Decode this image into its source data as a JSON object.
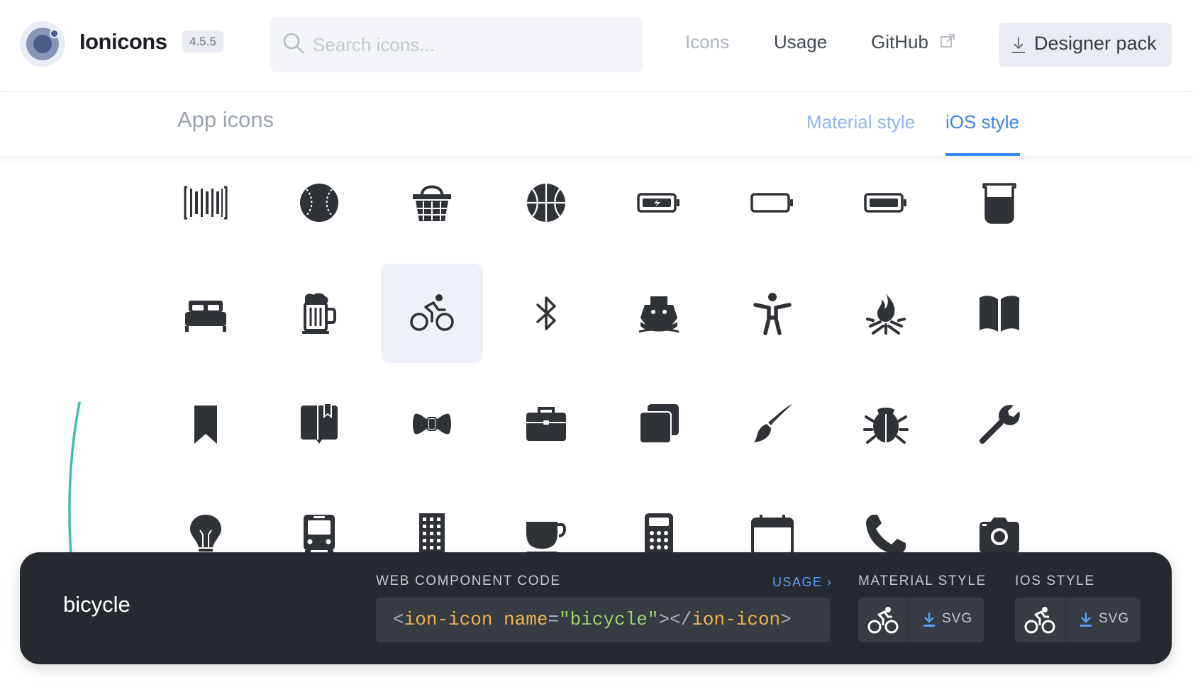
{
  "header": {
    "brand": "Ionicons",
    "version": "4.5.5",
    "search_placeholder": "Search icons...",
    "nav": {
      "icons": "Icons",
      "usage": "Usage",
      "github": "GitHub"
    },
    "designer_pack": "Designer pack"
  },
  "subheader": {
    "title": "App icons",
    "tabs": [
      {
        "label": "Material style",
        "active": false
      },
      {
        "label": "iOS style",
        "active": true
      }
    ]
  },
  "grid": {
    "rows": [
      [
        "barcode-icon",
        "baseball-icon",
        "basket-icon",
        "basketball-icon",
        "battery-charging-icon",
        "battery-dead-icon",
        "battery-full-icon",
        "beaker-icon"
      ],
      [
        "bed-icon",
        "beer-icon",
        "bicycle-icon",
        "bluetooth-icon",
        "boat-icon",
        "body-icon",
        "bonfire-icon",
        "book-icon"
      ],
      [
        "bookmark-icon",
        "bookmarks-icon",
        "bowtie-icon",
        "briefcase-icon",
        "browsers-icon",
        "brush-icon",
        "bug-icon",
        "build-icon"
      ],
      [
        "bulb-icon",
        "bus-icon",
        "business-icon",
        "cafe-icon",
        "calculator-icon",
        "calendar-icon",
        "call-icon",
        "camera-icon"
      ]
    ],
    "selected": "bicycle-icon"
  },
  "colors": {
    "accent": "#3a86f0",
    "panel": "#262a30",
    "arrow": "#3fbfa9",
    "icon": "#2f3237"
  },
  "panel": {
    "icon_name": "bicycle",
    "code_caption": "WEB COMPONENT CODE",
    "usage_link": "USAGE ›",
    "code": {
      "open": "<",
      "tag": "ion-icon",
      "attr": "name",
      "eq": "=",
      "value": "\"bicycle\"",
      "mid": "></",
      "close": ">"
    },
    "material_caption": "MATERIAL STYLE",
    "ios_caption": "IOS STYLE",
    "svg_label": "SVG"
  }
}
